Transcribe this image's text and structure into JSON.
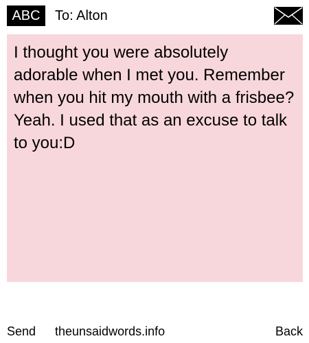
{
  "header": {
    "input_mode_label": "ABC",
    "recipient": "To: Alton",
    "compose_icon": "envelope-icon"
  },
  "message": {
    "text": "I thought you were absolutely adorable when I met you. Remember when you hit my mouth with a frisbee? Yeah. I used that as an excuse to talk to you:D",
    "background_color": "#f8d7dc"
  },
  "footer": {
    "send_label": "Send",
    "site_label": "theunsaidwords.info",
    "back_label": "Back"
  }
}
